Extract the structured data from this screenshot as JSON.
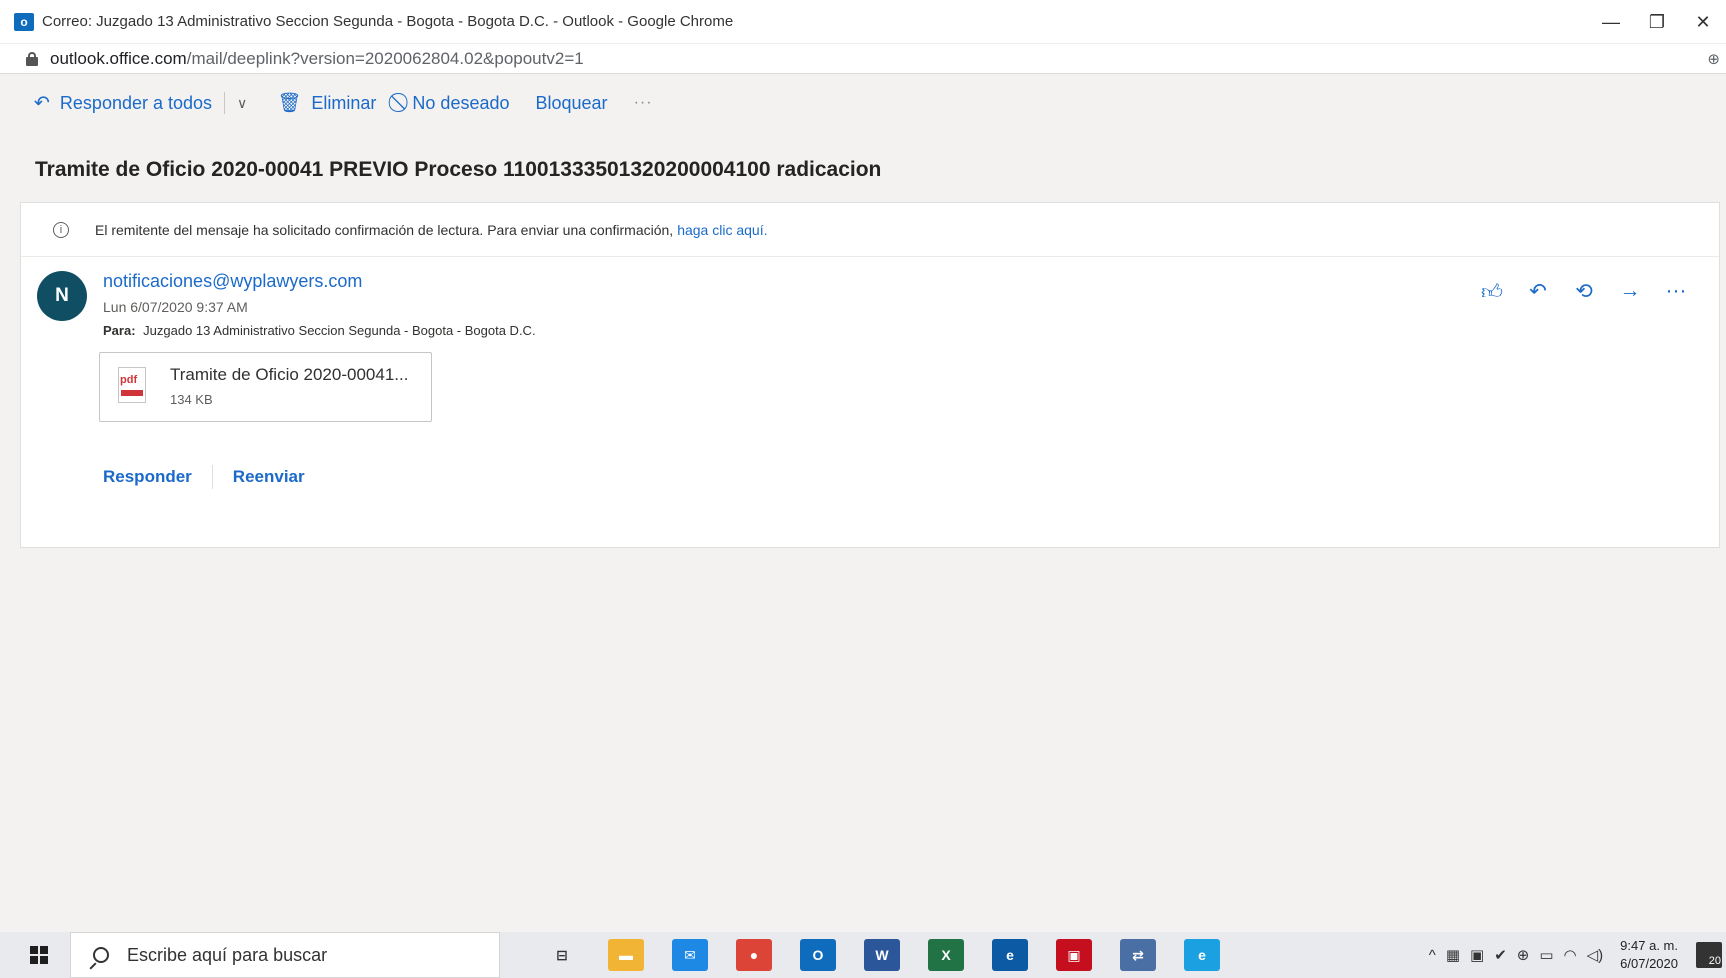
{
  "window": {
    "title": "Correo: Juzgado 13 Administrativo Seccion Segunda - Bogota - Bogota D.C. - Outlook - Google Chrome",
    "app_icon_letter": "o",
    "minimize": "—",
    "restore": "❐",
    "close": "✕"
  },
  "browser": {
    "url_host": "outlook.office.com",
    "url_path": "/mail/deeplink?version=2020062804.02&popoutv2=1"
  },
  "toolbar": {
    "reply_all_label": "Responder a todos",
    "delete_label": "Eliminar",
    "junk_label": "No deseado",
    "block_label": "Bloquear",
    "more_label": "···"
  },
  "message": {
    "subject": "Tramite de Oficio 2020-00041 PREVIO Proceso 11001333501320200004100 radicacion",
    "read_receipt_text": "El remitente del mensaje ha solicitado confirmación de lectura. Para enviar una confirmación,",
    "read_receipt_link": "haga clic aquí.",
    "avatar_initial": "N",
    "sender": "notificaciones@wyplawyers.com",
    "date": "Lun 6/07/2020 9:37 AM",
    "to_label": "Para:",
    "to_value": "Juzgado 13 Administrativo Seccion Segunda - Bogota - Bogota D.C.",
    "attachment": {
      "name": "Tramite de Oficio 2020-00041...",
      "size": "134 KB",
      "type_label": "pdf"
    },
    "reply_label": "Responder",
    "forward_label": "Reenviar",
    "more_label": "···"
  },
  "taskbar": {
    "search_placeholder": "Escribe aquí para buscar",
    "time": "9:47 a. m.",
    "date": "6/07/2020",
    "notification_count": "20",
    "apps": [
      {
        "name": "task-view",
        "color": "#e9eaee",
        "glyph": "⊟"
      },
      {
        "name": "file-explorer",
        "color": "#f1b434",
        "glyph": "▬"
      },
      {
        "name": "mail",
        "color": "#1e88e5",
        "glyph": "✉"
      },
      {
        "name": "chrome",
        "color": "#db4437",
        "glyph": "●"
      },
      {
        "name": "outlook",
        "color": "#0f6cbd",
        "glyph": "O"
      },
      {
        "name": "word",
        "color": "#2b579a",
        "glyph": "W"
      },
      {
        "name": "excel",
        "color": "#217346",
        "glyph": "X"
      },
      {
        "name": "edge",
        "color": "#0c59a4",
        "glyph": "e"
      },
      {
        "name": "security",
        "color": "#c50f1f",
        "glyph": "▣"
      },
      {
        "name": "network-app",
        "color": "#4a6fa5",
        "glyph": "⇄"
      },
      {
        "name": "internet-explorer",
        "color": "#1ba1e2",
        "glyph": "e"
      }
    ]
  },
  "colors": {
    "accent": "#1b6ac9",
    "avatar_bg": "#104f63",
    "pane_bg": "#f3f2f1"
  }
}
